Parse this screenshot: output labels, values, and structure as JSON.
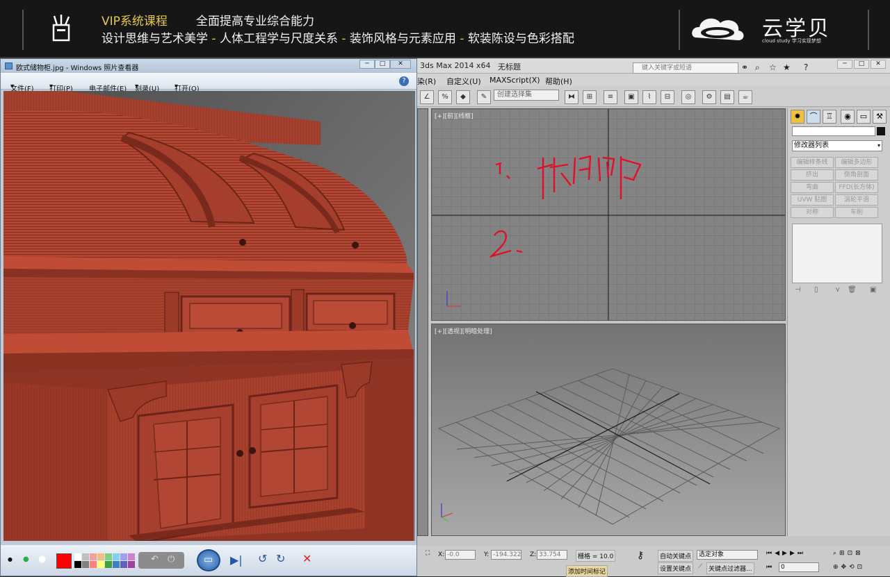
{
  "banner": {
    "vip_title": "VIP系统课程",
    "headline": "全面提高专业综合能力",
    "topics": [
      "设计思维与艺术美学",
      "人体工程学与尺度关系",
      "装饰风格与元素应用",
      "软装陈设与色彩搭配"
    ],
    "divider": "-",
    "logo_cn": "云学贝",
    "logo_en": "cloud study 学习实现梦想"
  },
  "photo_viewer": {
    "title": "欧式储物柜.jpg - Windows 照片查看器",
    "menu": [
      {
        "label": "文件(F)",
        "arrow": "▾"
      },
      {
        "label": "打印(P)",
        "arrow": "▾"
      },
      {
        "label": "电子邮件(E)",
        "arrow": ""
      },
      {
        "label": "刻录(U)",
        "arrow": "▾"
      },
      {
        "label": "打开(O)",
        "arrow": "▾"
      }
    ],
    "help": "?",
    "window_buttons": [
      "─",
      "□",
      "✕"
    ],
    "palette": [
      "#ff0000",
      "#ffffff",
      "#000000",
      "#c0c0c0",
      "#f4a0a0",
      "#f0c080",
      "#80d080",
      "#80d0f0",
      "#a0a0f0",
      "#d080d0",
      "#ff8080",
      "#ffff80"
    ]
  },
  "max": {
    "app_title": "3ds Max  2014 x64",
    "doc_title": "无标题",
    "search_placeholder": "键入关键字或短语",
    "menu": [
      "染(R)",
      "自定义(U)",
      "MAXScript(X)",
      "帮助(H)"
    ],
    "selection_set": "创建选择集",
    "viewports": {
      "top_label": "[+][前][线框]",
      "persp_label": "[+][透视][明暗处理]",
      "annotation_1": "1、拆面部",
      "annotation_2": "2、"
    },
    "command_panel": {
      "modifier_list": "修改器列表",
      "buttons": [
        "编辑样条线",
        "编辑多边形",
        "挤出",
        "倒角剖面",
        "弯曲",
        "FFD(长方体)",
        "UVW 贴图",
        "涡轮平滑",
        "对称",
        "车削"
      ]
    },
    "status": {
      "x_label": "X:",
      "x_value": "-0.0",
      "y_label": "Y:",
      "y_value": "-194.322",
      "z_label": "Z:",
      "z_value": "33.754",
      "grid": "栅格 = 10.0",
      "auto_key": "自动关键点",
      "set_key": "设置关键点",
      "selected": "选定对象",
      "key_filters": "关键点过滤器...",
      "add_time_tag": "添加时间标记",
      "frame": "0"
    }
  }
}
